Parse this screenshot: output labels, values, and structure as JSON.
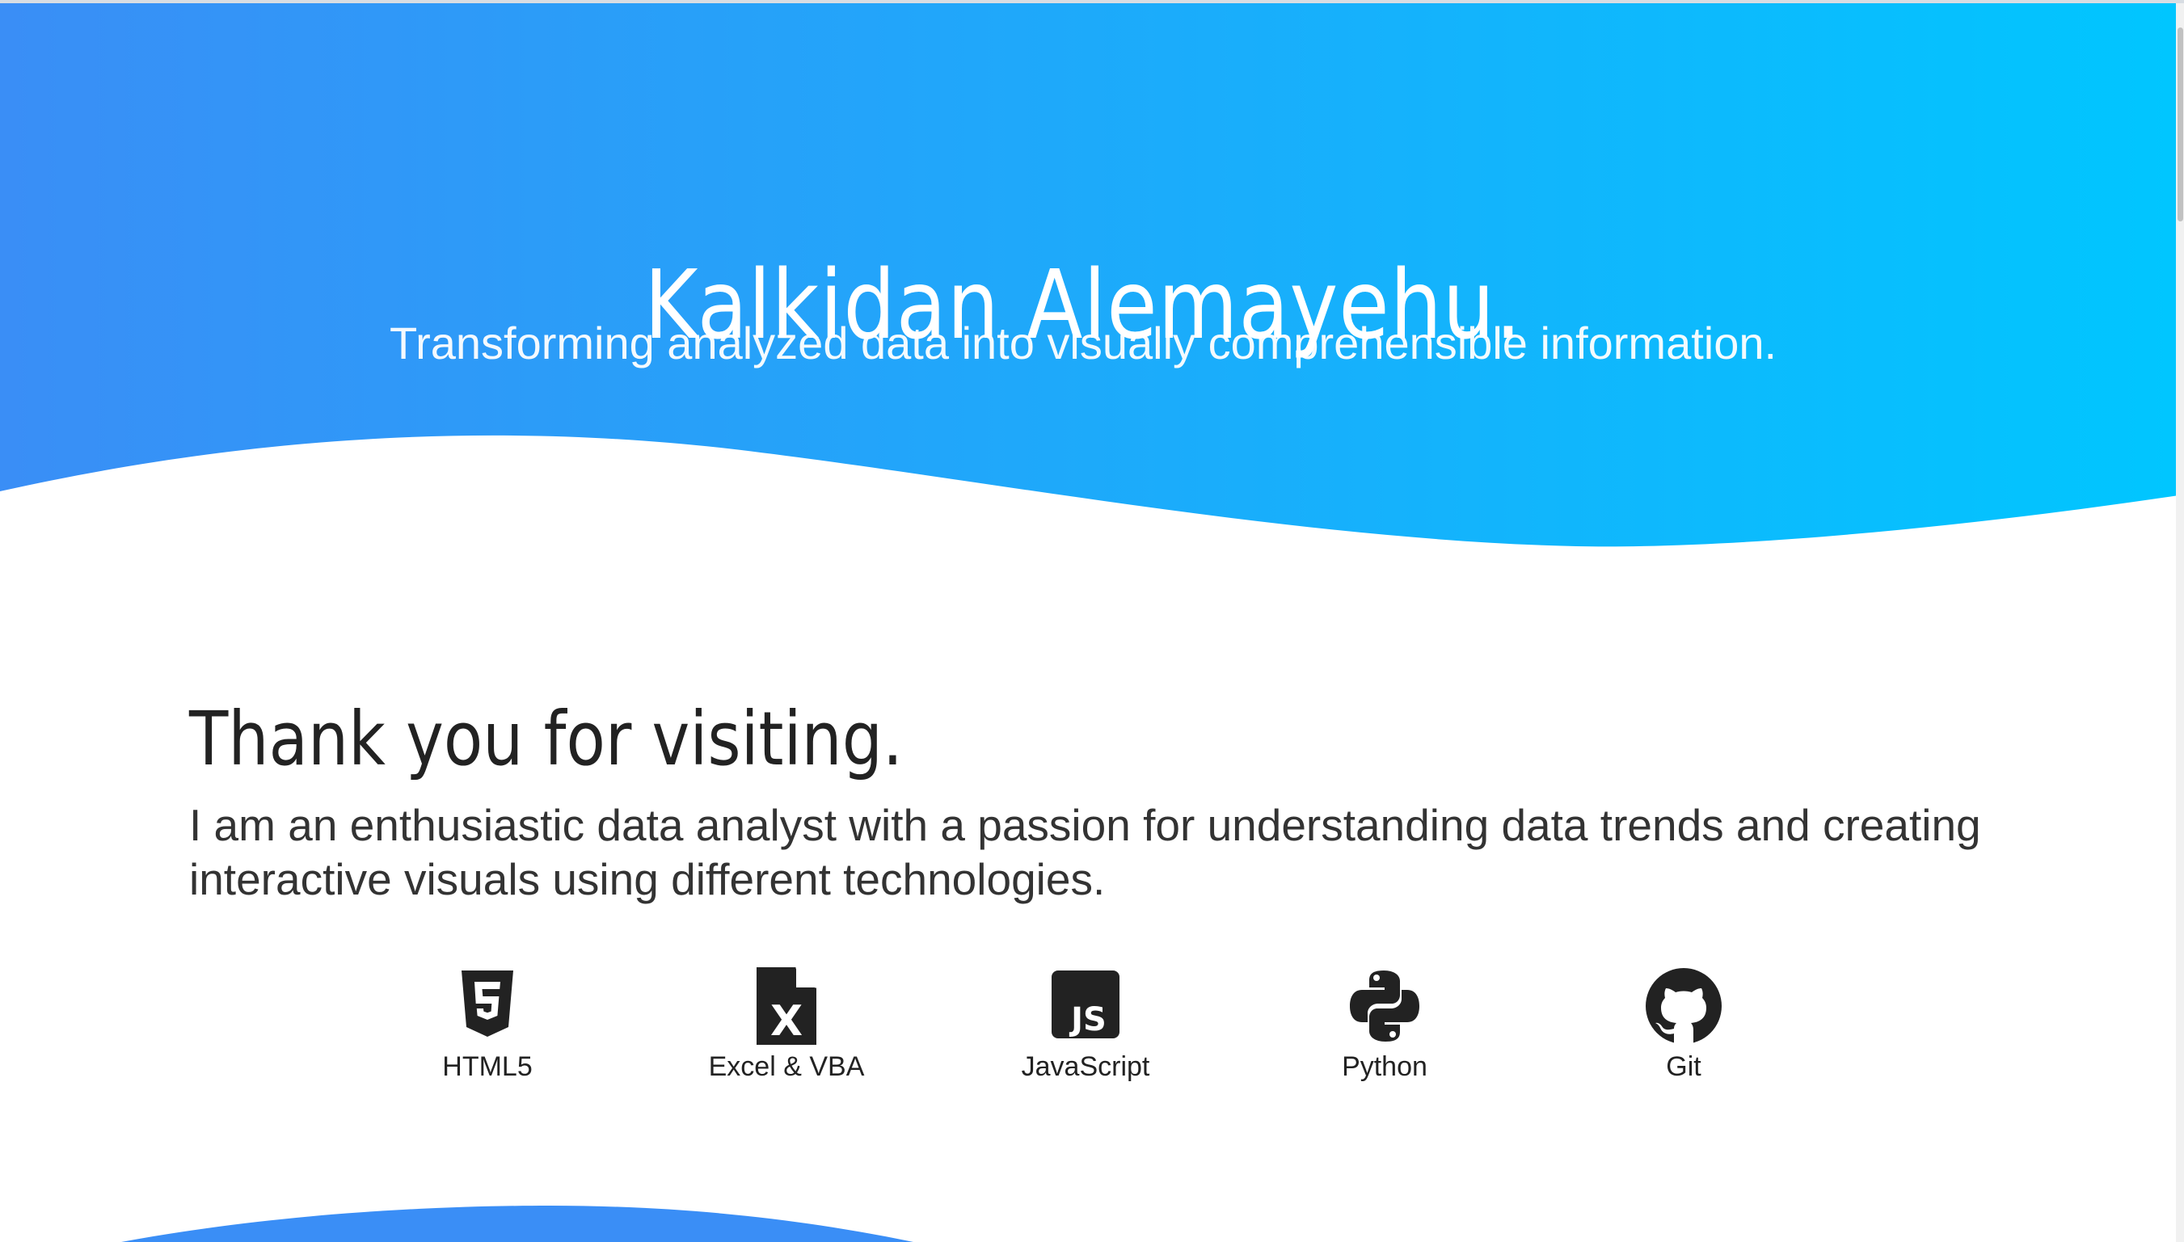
{
  "hero": {
    "title": "Kalkidan Alemayehu.",
    "subtitle": "Transforming analyzed data into visually comprehensible information.",
    "gradient_start": "#3a8ef6",
    "gradient_end": "#00c6ff"
  },
  "about": {
    "heading": "Thank you for visiting.",
    "text": "I am an enthusiastic data analyst with a passion for understanding data trends and creating interactive visuals using different technologies."
  },
  "skills": [
    {
      "label": "HTML5",
      "icon": "html5-icon"
    },
    {
      "label": "Excel & VBA",
      "icon": "excel-file-icon"
    },
    {
      "label": "JavaScript",
      "icon": "javascript-icon"
    },
    {
      "label": "Python",
      "icon": "python-icon"
    },
    {
      "label": "Git",
      "icon": "github-icon"
    }
  ],
  "colors": {
    "text_dark": "#222222",
    "icon": "#222222",
    "wave_blue": "#3a8ef6"
  }
}
